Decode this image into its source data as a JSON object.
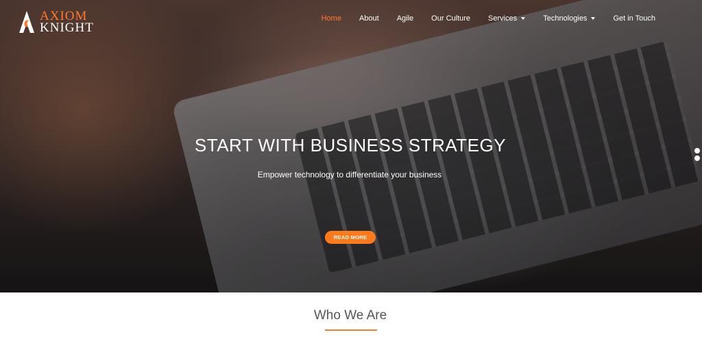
{
  "brand": {
    "line1": "AXIOM",
    "line2": "KNIGHT",
    "accent_color": "#ff7a2e"
  },
  "nav": {
    "items": [
      {
        "label": "Home",
        "active": true,
        "dropdown": false
      },
      {
        "label": "About",
        "active": false,
        "dropdown": false
      },
      {
        "label": "Agile",
        "active": false,
        "dropdown": false
      },
      {
        "label": "Our Culture",
        "active": false,
        "dropdown": false
      },
      {
        "label": "Services",
        "active": false,
        "dropdown": true
      },
      {
        "label": "Technologies",
        "active": false,
        "dropdown": true
      },
      {
        "label": "Get in Touch",
        "active": false,
        "dropdown": false
      }
    ]
  },
  "hero": {
    "headline": "START WITH BUSINESS STRATEGY",
    "subheadline": "Empower technology to differentiate your business",
    "cta_label": "READ MORE",
    "cta_color": "#ff7a1a",
    "slide_count": 2
  },
  "section": {
    "title": "Who We Are"
  },
  "icons": {
    "logo": "knight-chess-logo-icon",
    "dropdown": "caret-down-icon"
  }
}
